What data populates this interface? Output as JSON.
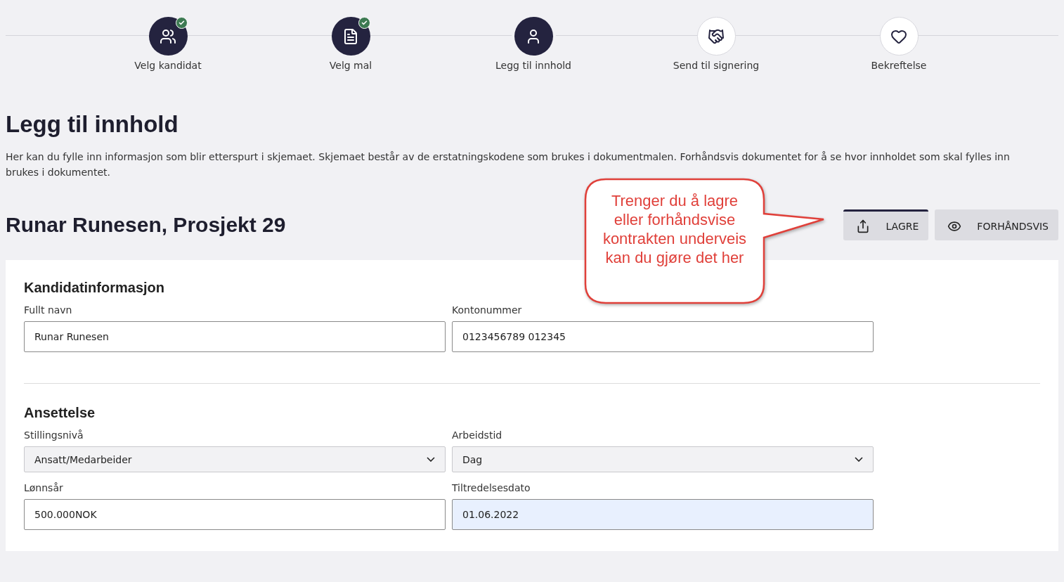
{
  "steps": [
    {
      "label": "Velg kandidat",
      "completed": true,
      "selected": false
    },
    {
      "label": "Velg mal",
      "completed": true,
      "selected": false
    },
    {
      "label": "Legg til innhold",
      "completed": false,
      "selected": true
    },
    {
      "label": "Send til signering",
      "completed": false,
      "selected": false
    },
    {
      "label": "Bekreftelse",
      "completed": false,
      "selected": false
    }
  ],
  "title": "Legg til innhold",
  "intro": "Her kan du fylle inn informasjon som blir etterspurt i skjemaet. Skjemaet består av de erstatningskodene som brukes i dokumentmalen. Forhåndsvis dokumentet for å se hvor innholdet som skal fylles inn brukes i dokumentet.",
  "subtitle": "Runar Runesen, Prosjekt 29",
  "actions": [
    {
      "label": "LAGRE",
      "selected": true
    },
    {
      "label": "FORHÅNDSVIS",
      "selected": false
    }
  ],
  "callout": "Trenger du å lagre eller forhåndsvise kontrakten underveis kan du gjøre det her",
  "sections": [
    {
      "title": "Kandidatinformasjon",
      "fields": [
        {
          "kind": "text",
          "label": "Fullt navn",
          "value": "Runar Runesen"
        },
        {
          "kind": "text",
          "label": "Kontonummer",
          "value": "0123456789 012345"
        }
      ]
    },
    {
      "title": "Ansettelse",
      "fields": [
        {
          "kind": "select",
          "label": "Stillingsnivå",
          "value": "Ansatt/Medarbeider"
        },
        {
          "kind": "select",
          "label": "Arbeidstid",
          "value": "Dag"
        },
        {
          "kind": "text",
          "label": "Lønnsår",
          "value": "500.000NOK"
        },
        {
          "kind": "date",
          "label": "Tiltredelsesdato",
          "value": "01.06.2022"
        }
      ]
    }
  ]
}
